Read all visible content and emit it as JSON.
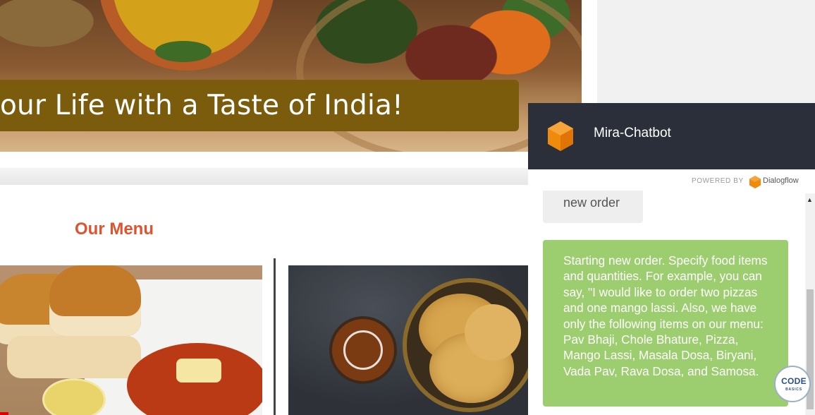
{
  "hero": {
    "title": "our Life with a Taste of India!"
  },
  "menu": {
    "heading": "Our Menu"
  },
  "chatbot": {
    "title": "Mira-Chatbot",
    "powered_by": "POWERED BY",
    "provider": "Dialogflow",
    "messages": [
      {
        "role": "user",
        "text": "new order"
      },
      {
        "role": "bot",
        "text": "Starting new order. Specify food items and quantities. For example, you can say, \"I would like to order two pizzas and one mango lassi. Also, we have only the following items on our menu: Pav Bhaji, Chole Bhature, Pizza, Mango Lassi, Masala Dosa, Biryani, Vada Pav, Rava Dosa, and Samosa."
      }
    ]
  },
  "watermark": {
    "main": "CODE",
    "sub": "BASICS"
  },
  "colors": {
    "accent_heading": "#e2522f",
    "hero_band": "#7a5c0c",
    "chat_header": "#2b2f3a",
    "bot_bubble": "#9ccd6e",
    "user_bubble": "#eeeeee"
  }
}
